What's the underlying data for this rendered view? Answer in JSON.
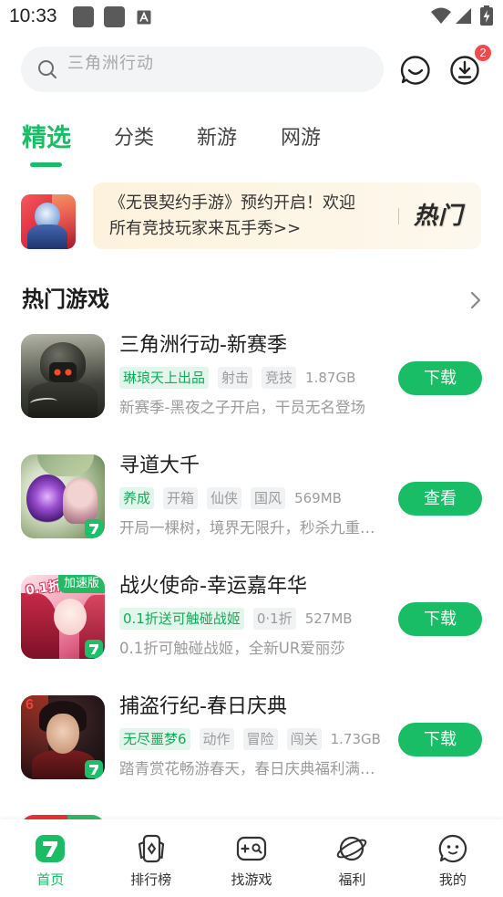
{
  "status_bar": {
    "time": "10:33",
    "icons": [
      "notification-icon",
      "notification-icon",
      "keyboard-a-icon",
      "wifi-icon",
      "signal-icon",
      "battery-charging-icon"
    ]
  },
  "header": {
    "search_placeholder": "三角洲行动",
    "search_icon": "search-icon",
    "message_icon": "chat-smile-icon",
    "download_icon": "download-icon",
    "download_badge": "2"
  },
  "tabs": [
    {
      "label": "精选",
      "active": true
    },
    {
      "label": "分类",
      "active": false
    },
    {
      "label": "新游",
      "active": false
    },
    {
      "label": "网游",
      "active": false
    }
  ],
  "banner": {
    "line1": "《无畏契约手游》预约开启！欢迎",
    "line2": "所有竞技玩家来瓦手秀>>",
    "tag": "热门"
  },
  "section": {
    "title": "热门游戏",
    "more_icon": "chevron-right-icon"
  },
  "games": [
    {
      "title": "三角洲行动-新赛季",
      "tags": [
        {
          "text": "琳琅天上出品",
          "variant": "green"
        },
        {
          "text": "射击",
          "variant": "gray"
        },
        {
          "text": "竞技",
          "variant": "gray"
        }
      ],
      "size": "1.87GB",
      "desc": "新赛季-黑夜之子开启，干员无名登场",
      "button": "下载"
    },
    {
      "title": "寻道大千",
      "tags": [
        {
          "text": "养成",
          "variant": "green"
        },
        {
          "text": "开箱",
          "variant": "gray"
        },
        {
          "text": "仙侠",
          "variant": "gray"
        },
        {
          "text": "国风",
          "variant": "gray"
        }
      ],
      "size": "569MB",
      "desc": "开局一棵树，境界无限升，秒杀九重…",
      "button": "查看"
    },
    {
      "title": "战火使命-幸运嘉年华",
      "icon_badge": "加速版",
      "icon_overlay": "0.1折",
      "tags": [
        {
          "text": "0.1折送可触碰战姬",
          "variant": "green"
        },
        {
          "text": "0·1折",
          "variant": "gray"
        }
      ],
      "size": "527MB",
      "desc": "0.1折可触碰战姬，全新UR爱丽莎",
      "button": "下载"
    },
    {
      "title": "捕盗行纪-春日庆典",
      "icon_overlay": "6",
      "tags": [
        {
          "text": "无尽噩梦6",
          "variant": "green"
        },
        {
          "text": "动作",
          "variant": "gray"
        },
        {
          "text": "冒险",
          "variant": "gray"
        },
        {
          "text": "闯关",
          "variant": "gray"
        }
      ],
      "size": "1.73GB",
      "desc": "踏青赏花畅游春天，春日庆典福利满…",
      "button": "下载"
    }
  ],
  "bottom_nav": [
    {
      "label": "首页",
      "icon": "home-logo-icon",
      "active": true
    },
    {
      "label": "排行榜",
      "icon": "ranking-icon",
      "active": false
    },
    {
      "label": "找游戏",
      "icon": "find-game-icon",
      "active": false
    },
    {
      "label": "福利",
      "icon": "welfare-planet-icon",
      "active": false
    },
    {
      "label": "我的",
      "icon": "profile-face-icon",
      "active": false
    }
  ],
  "colors": {
    "accent": "#19bd65",
    "badge": "#f2494b",
    "tag_green_bg": "#e3f6eb",
    "tag_green_text": "#17a95a",
    "tag_gray_bg": "#f1f2f4",
    "tag_gray_text": "#9b9b9b"
  }
}
